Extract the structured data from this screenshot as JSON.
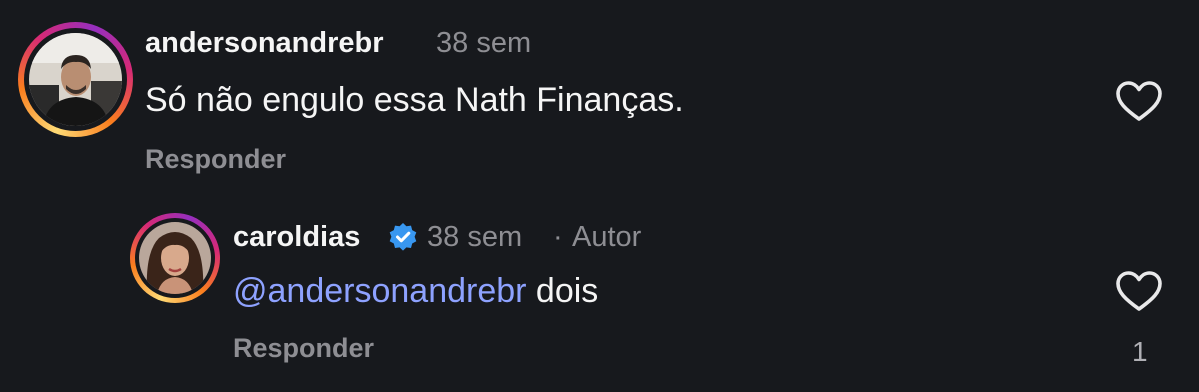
{
  "comments": [
    {
      "username": "andersonandrebr",
      "time": "38 sem",
      "text": "Só não engulo essa Nath Finanças.",
      "reply_label": "Responder",
      "avatar": "man-portrait-avatar",
      "like_icon": "heart-outline-icon"
    },
    {
      "username": "caroldias",
      "verified": true,
      "time": "38 sem",
      "separator": "·",
      "author_tag": "Autor",
      "mention": "@andersonandrebr",
      "text": " dois",
      "reply_label": "Responder",
      "avatar": "woman-portrait-avatar",
      "like_icon": "heart-outline-icon",
      "like_count": "1"
    }
  ],
  "colors": {
    "background": "#17191d",
    "mention": "#8ea2ff",
    "verified": "#3897f0",
    "muted": "#8e8e93"
  }
}
